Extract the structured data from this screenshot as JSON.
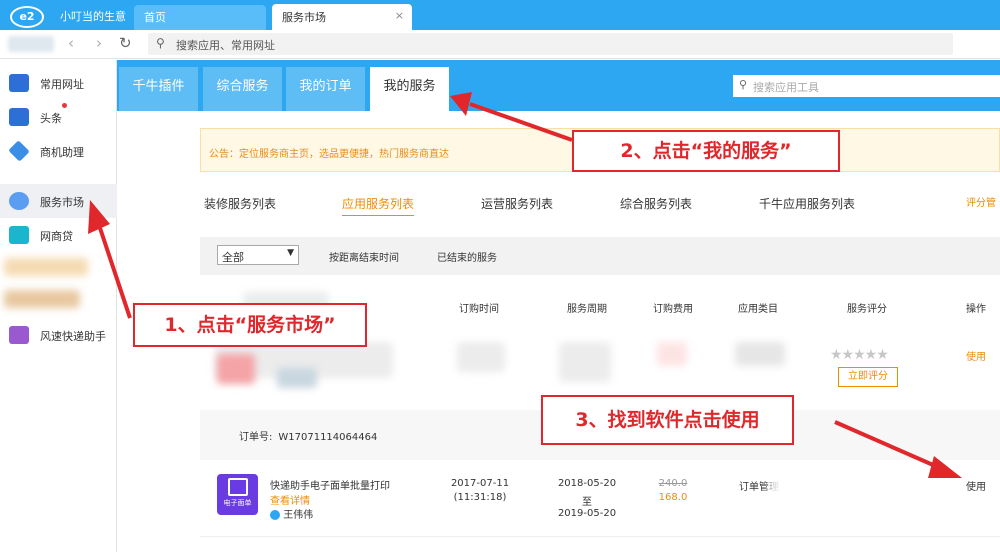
{
  "titlebar": {
    "logo": "e2",
    "shop_name": "小叮当的生意",
    "tabs": [
      {
        "label": "首页"
      },
      {
        "label": "服务市场",
        "close": "×"
      }
    ]
  },
  "addressbar": {
    "back": "‹",
    "forward": "›",
    "refresh": "↻",
    "search_placeholder": "搜索应用、常用网址"
  },
  "sidebar": {
    "items": [
      {
        "label": "常用网址",
        "icon": "globe-icon"
      },
      {
        "label": "头条",
        "icon": "news-icon"
      },
      {
        "label": "商机助理",
        "icon": "chart-icon"
      },
      {
        "label": "服务市场",
        "icon": "heart-icon"
      },
      {
        "label": "网商贷",
        "icon": "gamepad-icon"
      },
      {
        "label": "风速快递助手",
        "icon": "delivery-icon"
      }
    ]
  },
  "main": {
    "tabs": [
      "千牛插件",
      "综合服务",
      "我的订单",
      "我的服务"
    ],
    "active_tab": 3,
    "tool_search_placeholder": "搜索应用工具",
    "notice": "公告：定位服务商主页，选品更便捷，热门服务商直达",
    "subtabs": [
      "装修服务列表",
      "应用服务列表",
      "运营服务列表",
      "综合服务列表",
      "千牛应用服务列表"
    ],
    "active_subtab": 1,
    "rate_manage": "评分管",
    "filter": {
      "select_value": "全部",
      "options": [
        "按距离结束时间",
        "已结束的服务"
      ]
    },
    "table": {
      "headers": [
        "订购时间",
        "服务周期",
        "订购费用",
        "应用类目",
        "服务评分",
        "操作"
      ],
      "row1": {
        "rating": "★★★★★",
        "rate_button": "立即评分",
        "action": "使用"
      },
      "order_label": "订单号:",
      "order_no": "W17071114064464",
      "row2": {
        "app_icon_label": "电子面单",
        "name": "快递助手电子面单批量打印",
        "detail_link": "查看详情",
        "vendor": "王伟伟",
        "order_date": "2017-07-11",
        "order_time": "(11:31:18)",
        "period_start": "2018-05-20",
        "period_to": "至",
        "period_end": "2019-05-20",
        "price_original": "240.0",
        "price": "168.0",
        "category": "订单管理",
        "action": "使用"
      }
    }
  },
  "annotations": [
    "1、点击“服务市场”",
    "2、点击“我的服务”",
    "3、找到软件点击使用"
  ]
}
